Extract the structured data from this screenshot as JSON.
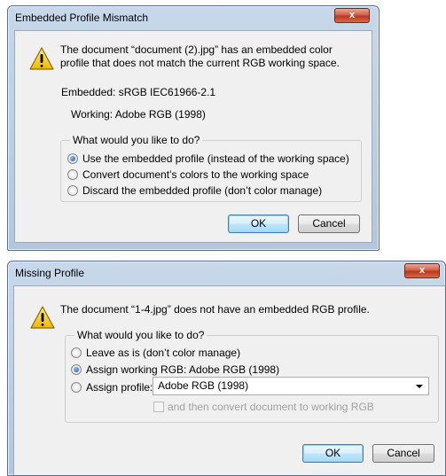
{
  "dialog1": {
    "title": "Embedded Profile Mismatch",
    "close_label": "x",
    "message_line1": "The document “document (2).jpg” has an embedded color",
    "message_line2": "profile that does not match the current RGB working space.",
    "embedded_text": "Embedded:  sRGB IEC61966-2.1",
    "working_text": "Working:  Adobe RGB (1998)",
    "group_label": "What would you like to do?",
    "options": [
      {
        "label": "Use the embedded profile (instead of the working space)",
        "checked": true
      },
      {
        "label": "Convert document’s colors to the working space",
        "checked": false
      },
      {
        "label": "Discard the embedded profile (don’t color manage)",
        "checked": false
      }
    ],
    "ok_label": "OK",
    "cancel_label": "Cancel"
  },
  "dialog2": {
    "title": "Missing Profile",
    "close_label": "x",
    "message": "The document “1-4.jpg” does not have an embedded RGB profile.",
    "group_label": "What would you like to do?",
    "option_leave": "Leave as is (don’t color manage)",
    "option_assign_working": "Assign working RGB:  Adobe RGB (1998)",
    "option_assign_profile": "Assign profile:",
    "selected_option": "assign_working",
    "profile_select_value": "Adobe RGB (1998)",
    "convert_checkbox_label": "and then convert document to working RGB",
    "convert_checkbox_checked": false,
    "ok_label": "OK",
    "cancel_label": "Cancel"
  },
  "colors": {
    "title_bar": "#b3c6dd",
    "close_button": "#cf5a3f",
    "client_bg": "#f0f0f0",
    "default_button_border": "#3c7fb1"
  }
}
